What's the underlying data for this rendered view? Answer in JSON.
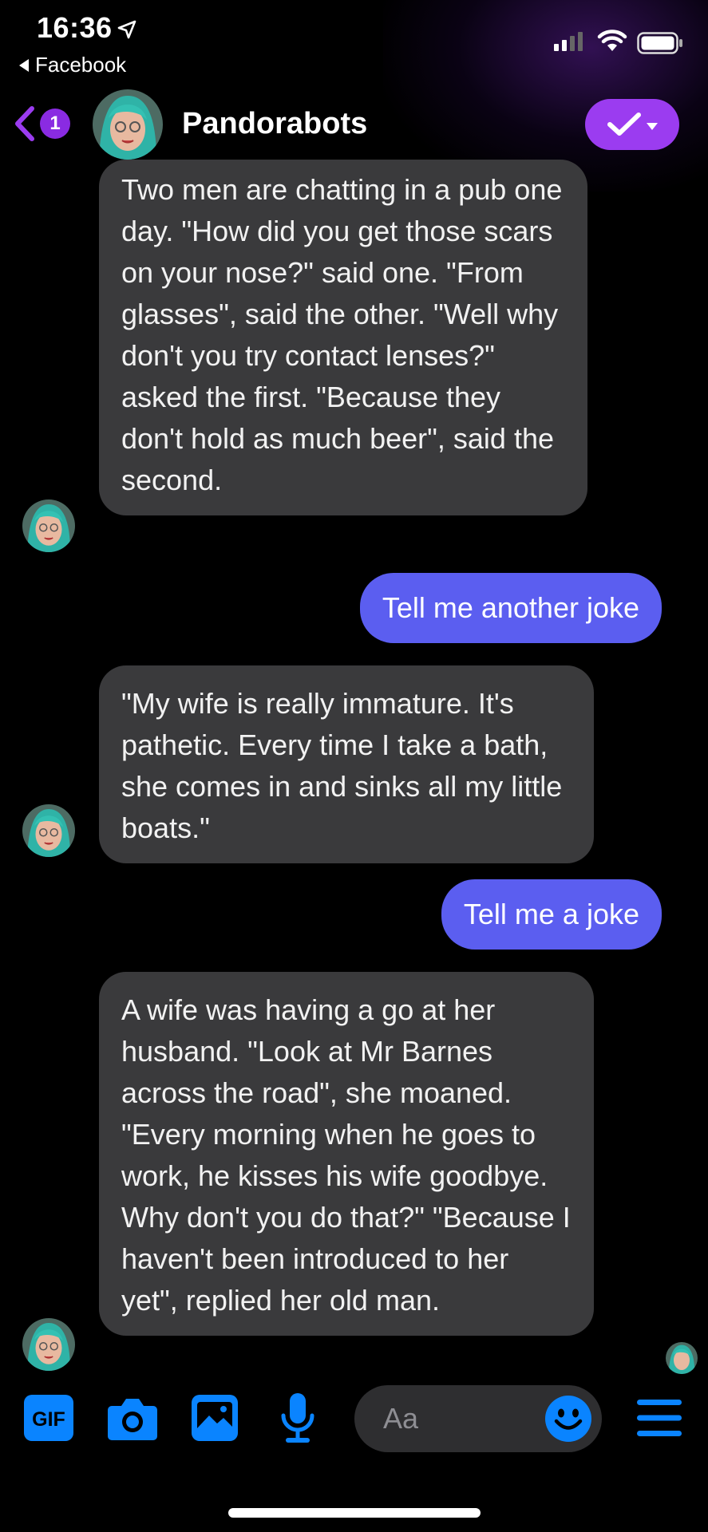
{
  "status_bar": {
    "time": "16:36",
    "back_app": "Facebook"
  },
  "header": {
    "unread_badge": "1",
    "title": "Pandorabots",
    "accent_color": "#9b3cf0"
  },
  "messages": [
    {
      "direction": "incoming",
      "text": "Two men are chatting in a pub one day. \"How did you get those scars on your nose?\" said one. \"From glasses\", said the other. \"Well why don't you try contact lenses?\" asked the first. \"Because they don't hold as much beer\", said the second."
    },
    {
      "direction": "outgoing",
      "text": "Tell me another joke"
    },
    {
      "direction": "incoming",
      "text": "\"My wife is really immature. It's pathetic. Every time I take a bath, she comes in and sinks all my little boats.\""
    },
    {
      "direction": "outgoing",
      "text": "Tell me a joke"
    },
    {
      "direction": "incoming",
      "text": "A wife was having a go at her husband. \"Look at Mr Barnes across the road\", she moaned. \"Every morning when he goes to work, he kisses his wife goodbye. Why don't you do that?\" \"Because I haven't been introduced to her yet\", replied her old man."
    }
  ],
  "composer": {
    "gif_label": "GIF",
    "placeholder": "Aa",
    "icons": [
      "gif-icon",
      "camera-icon",
      "image-icon",
      "microphone-icon",
      "emoji-icon",
      "menu-icon"
    ]
  },
  "colors": {
    "incoming_bubble": "#3a3a3c",
    "outgoing_bubble": "#5b5ef0",
    "composer_icon": "#0a84ff"
  }
}
